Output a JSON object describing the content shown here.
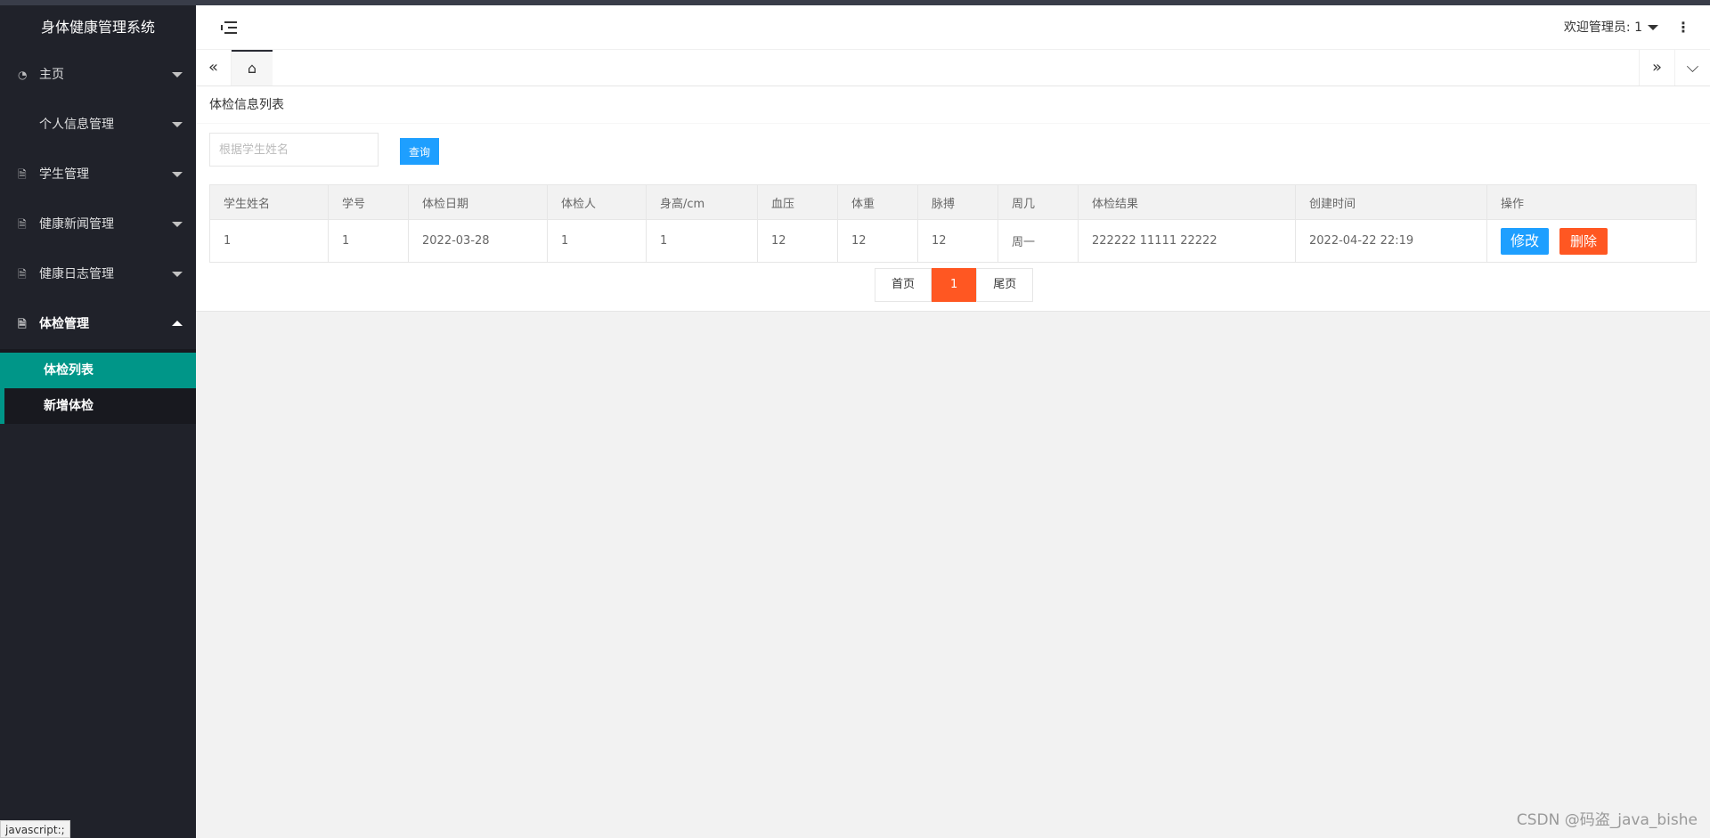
{
  "app_title": "身体健康管理系统",
  "sidebar": {
    "items": [
      {
        "label": "主页",
        "icon": "dashboard-icon"
      },
      {
        "label": "个人信息管理",
        "icon": ""
      },
      {
        "label": "学生管理",
        "icon": "document-icon"
      },
      {
        "label": "健康新闻管理",
        "icon": "document-icon"
      },
      {
        "label": "健康日志管理",
        "icon": "document-icon"
      },
      {
        "label": "体检管理",
        "icon": "document-icon",
        "expanded": true
      }
    ],
    "sub_items": [
      {
        "label": "体检列表",
        "active": true
      },
      {
        "label": "新增体检"
      }
    ]
  },
  "header": {
    "welcome": "欢迎管理员: 1",
    "more_icon": "⋮"
  },
  "tabs": {
    "home_icon": "⌂",
    "prev_icon": "«",
    "next_icon": "»",
    "down_icon": "⌵"
  },
  "main": {
    "card_title": "体检信息列表",
    "search": {
      "placeholder": "根据学生姓名",
      "value": "",
      "button": "查询"
    },
    "table": {
      "columns": [
        "学生姓名",
        "学号",
        "体检日期",
        "体检人",
        "身高/cm",
        "血压",
        "体重",
        "脉搏",
        "周几",
        "体检结果",
        "创建时间",
        "操作"
      ],
      "rows": [
        [
          "1",
          "1",
          "2022-03-28",
          "1",
          "1",
          "12",
          "12",
          "12",
          "周一",
          "222222 11111 22222",
          "2022-04-22 22:19"
        ]
      ],
      "edit_label": "修改",
      "delete_label": "删除"
    },
    "pagination": {
      "first": "首页",
      "current": "1",
      "last": "尾页"
    }
  },
  "status_tip": "javascript:;",
  "watermark": "CSDN @码盗_java_bishe",
  "colors": {
    "sidebar_bg": "#20222a",
    "active_menu": "#009688",
    "primary_btn": "#1e9fff",
    "danger_btn": "#ff5722"
  }
}
